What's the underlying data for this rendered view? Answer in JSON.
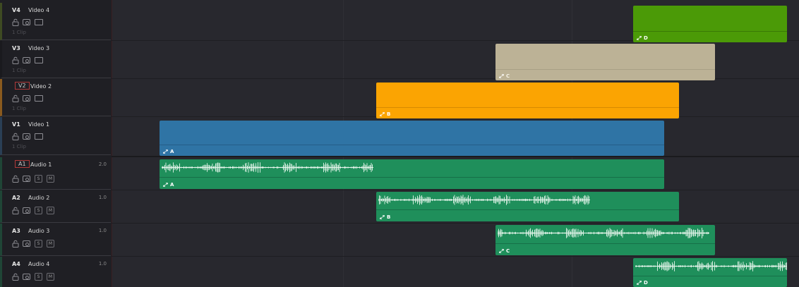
{
  "video_tracks": [
    {
      "id": "V4",
      "name": "Video 4",
      "clip_count": "1 Clip"
    },
    {
      "id": "V3",
      "name": "Video 3",
      "clip_count": "1 Clip"
    },
    {
      "id": "V2",
      "name": "Video 2",
      "clip_count": "1 Clip"
    },
    {
      "id": "V1",
      "name": "Video 1",
      "clip_count": "1 Clip"
    }
  ],
  "audio_tracks": [
    {
      "id": "A1",
      "name": "Audio 1",
      "channels": "2.0",
      "solo_label": "S",
      "mute_label": "M"
    },
    {
      "id": "A2",
      "name": "Audio 2",
      "channels": "1.0",
      "solo_label": "S",
      "mute_label": "M"
    },
    {
      "id": "A3",
      "name": "Audio 3",
      "channels": "1.0",
      "solo_label": "S",
      "mute_label": "M"
    },
    {
      "id": "A4",
      "name": "Audio 4",
      "channels": "1.0",
      "solo_label": "S",
      "mute_label": "M"
    }
  ],
  "clips": {
    "v4": {
      "name": "D",
      "color": "#4b9a07"
    },
    "v3": {
      "name": "C",
      "color": "#bcb296"
    },
    "v2": {
      "name": "B",
      "color": "#fba402"
    },
    "v1": {
      "name": "A",
      "color": "#2f74a5"
    },
    "a1": {
      "name": "A",
      "color": "#1f8f5b"
    },
    "a2": {
      "name": "B",
      "color": "#1f8f5b"
    },
    "a3": {
      "name": "C",
      "color": "#1f8f5b"
    },
    "a4": {
      "name": "D",
      "color": "#1f8f5b"
    }
  },
  "icons": {
    "lock": "lock-icon",
    "eye": "eye-icon",
    "monitor": "monitor-icon",
    "link": "link-icon"
  }
}
